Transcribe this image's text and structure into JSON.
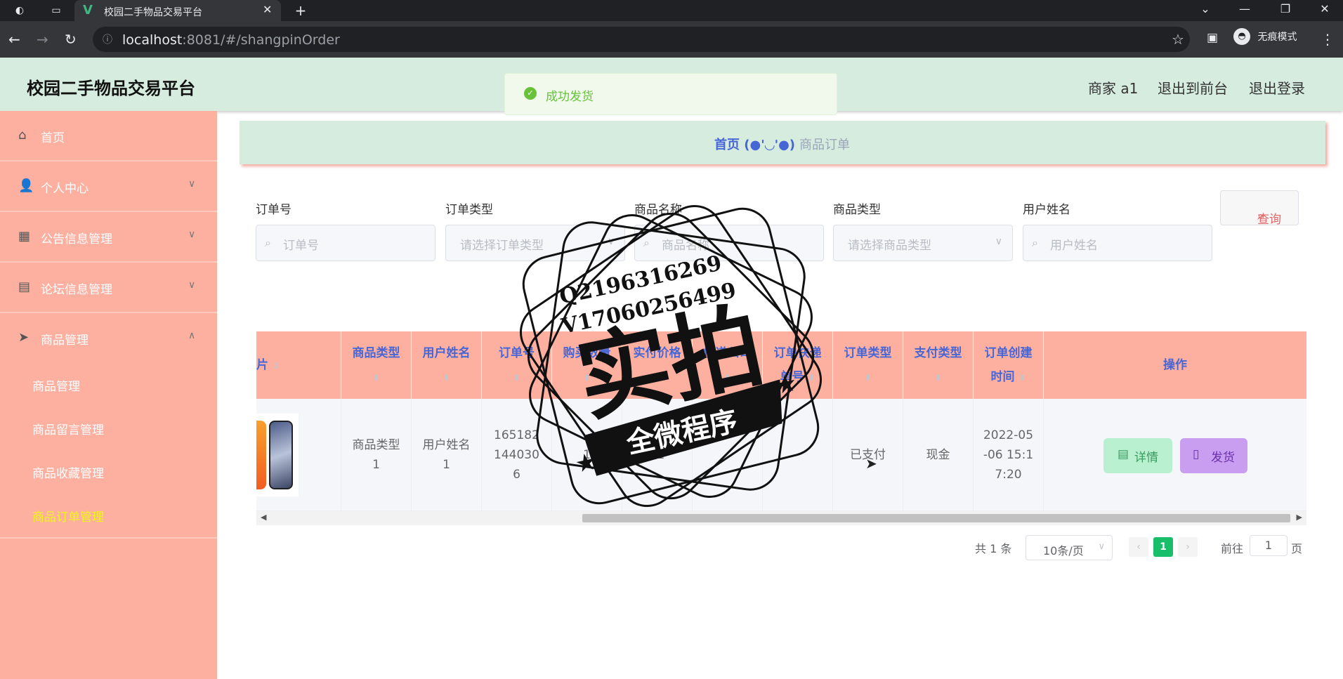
{
  "browser": {
    "tab_title": "校园二手物品交易平台",
    "url_host": "localhost",
    "url_rest": ":8081/#/shangpinOrder",
    "incognito_label": "无痕模式"
  },
  "header": {
    "brand": "校园二手物品交易平台",
    "user": "商家 a1",
    "exit_front": "退出到前台",
    "logout": "退出登录"
  },
  "toast": {
    "message": "成功发货"
  },
  "sidebar": {
    "items": [
      {
        "label": "首页",
        "icon": "home-icon"
      },
      {
        "label": "个人中心",
        "icon": "user-icon"
      },
      {
        "label": "公告信息管理",
        "icon": "chart-icon"
      },
      {
        "label": "论坛信息管理",
        "icon": "clipboard-icon"
      },
      {
        "label": "商品管理",
        "icon": "send-icon"
      }
    ],
    "subitems": [
      "商品管理",
      "商品留言管理",
      "商品收藏管理",
      "商品订单管理"
    ],
    "active_sub_color": "#f3f31e"
  },
  "breadcrumb": {
    "home": "首页",
    "sep": "(●'◡'●)",
    "current": "商品订单"
  },
  "search": {
    "labels": [
      "订单号",
      "订单类型",
      "商品名称",
      "商品类型",
      "用户姓名"
    ],
    "placeholders": [
      "订单号",
      "请选择订单类型",
      "商品名称",
      "请选择商品类型",
      "用户姓名"
    ],
    "query_button": "查询"
  },
  "table": {
    "headers": [
      "片",
      "商品类型",
      "用户姓名",
      "订单号",
      "购买数量",
      "实付价格",
      "快递公司",
      "订单快递单号",
      "订单类型",
      "支付类型",
      "订单创建时间",
      "操作"
    ],
    "row": {
      "goods_type": "商品类型1",
      "user_name": "用户姓名1",
      "order_no": "1651821440306",
      "quantity": "1",
      "price": "21",
      "courier": "",
      "tracking": "",
      "order_type": "已支付",
      "pay_type": "现金",
      "created": "2022-05-06 15:17:20"
    },
    "actions": {
      "detail": "详情",
      "ship": "发货"
    }
  },
  "pager": {
    "total": "共 1 条",
    "page_size": "10条/页",
    "current_page": "1",
    "goto_label": "前往",
    "goto_value": "1",
    "page_suffix": "页"
  },
  "watermark": {
    "line1": "Q2196316269",
    "line2": "V17060256499",
    "big": "实拍",
    "banner": "全微程序"
  },
  "colors": {
    "header_bg": "#d6ecdf",
    "sidebar_bg": "#fdb0a0",
    "accent_blue": "#4766d6",
    "success": "#67c23a"
  }
}
